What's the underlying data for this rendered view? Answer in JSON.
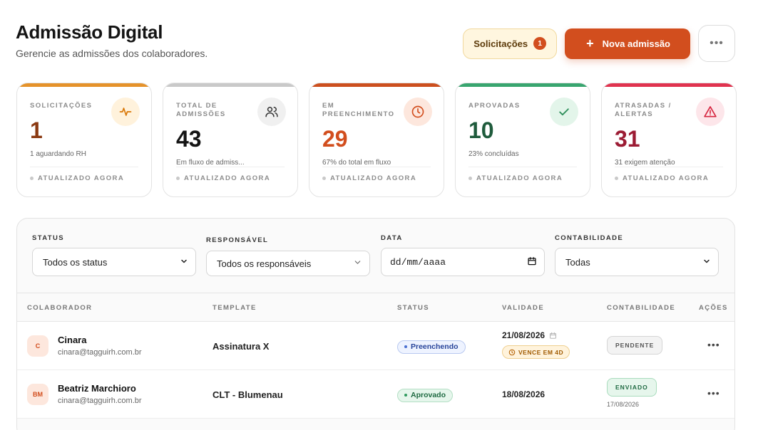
{
  "header": {
    "title": "Admissão Digital",
    "subtitle": "Gerencie as admissões dos colaboradores."
  },
  "actions": {
    "requests_label": "Solicitações",
    "requests_count": "1",
    "new_label": "Nova admissão",
    "more_label": "•••"
  },
  "colors": {
    "accent": "#d24e1e",
    "yellow": "#e5922a",
    "gray": "#c9c9c9",
    "orange": "#cc4f1e",
    "green": "#38a56f",
    "red": "#e0334f"
  },
  "cards": [
    {
      "label": "SOLICITAÇÕES",
      "value": "1",
      "note": "1 aguardando RH",
      "footer": "ATUALIZADO AGORA",
      "icon": "activity-icon"
    },
    {
      "label": "TOTAL DE ADMISSÕES",
      "value": "43",
      "note": "Em fluxo de admiss...",
      "footer": "ATUALIZADO AGORA",
      "icon": "users-icon"
    },
    {
      "label": "EM PREENCHIMENTO",
      "value": "29",
      "note": "67% do total em fluxo",
      "footer": "ATUALIZADO AGORA",
      "icon": "clock-icon"
    },
    {
      "label": "APROVADAS",
      "value": "10",
      "note": "23% concluídas",
      "footer": "ATUALIZADO AGORA",
      "icon": "check-icon"
    },
    {
      "label": "ATRASADAS / ALERTAS",
      "value": "31",
      "note": "31 exigem atenção",
      "footer": "ATUALIZADO AGORA",
      "icon": "alert-triangle-icon"
    }
  ],
  "filters": {
    "status": {
      "label": "STATUS",
      "value": "Todos os status"
    },
    "responsavel": {
      "label": "RESPONSÁVEL",
      "value": "Todos os responsáveis"
    },
    "data": {
      "label": "DATA",
      "value": "dd/mm/aaaa"
    },
    "contabilidade": {
      "label": "CONTABILIDADE",
      "value": "Todas"
    }
  },
  "table": {
    "headers": [
      "COLABORADOR",
      "TEMPLATE",
      "STATUS",
      "VALIDADE",
      "CONTABILIDADE",
      "AÇÕES"
    ],
    "rows": [
      {
        "initials": "C",
        "name": "Cinara",
        "email": "cinara@tagguirh.com.br",
        "template": "Assinatura X",
        "status": "Preenchendo",
        "validity": "21/08/2026",
        "warning": "VENCE EM 4D",
        "accounting": "PENDENTE",
        "accounting_date": "",
        "actions": "•••"
      },
      {
        "initials": "BM",
        "name": "Beatriz Marchioro",
        "email": "cinara@tagguirh.com.br",
        "template": "CLT - Blumenau",
        "status": "Aprovado",
        "validity": "18/08/2026",
        "warning": "",
        "accounting": "ENVIADO",
        "accounting_date": "17/08/2026",
        "actions": "•••"
      }
    ]
  }
}
